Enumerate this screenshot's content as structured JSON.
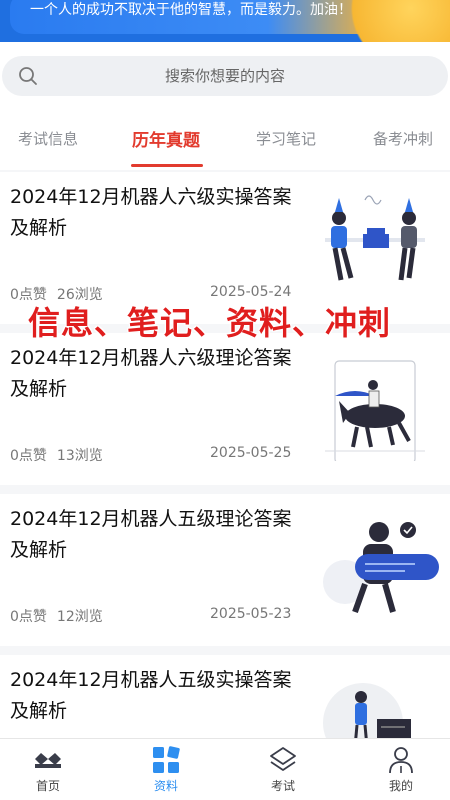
{
  "banner": {
    "quote": "一个人的成功不取决于他的智慧，而是毅力。加油！"
  },
  "search": {
    "placeholder": "搜索你想要的内容"
  },
  "tabs": [
    {
      "label": "考试信息",
      "active": false
    },
    {
      "label": "历年真题",
      "active": true
    },
    {
      "label": "学习笔记",
      "active": false
    },
    {
      "label": "备考冲刺",
      "active": false
    }
  ],
  "articles": [
    {
      "title": "2024年12月机器人六级实操答案及解析",
      "likes": "0点赞",
      "views": "26浏览",
      "date": "2025-05-24",
      "image": "party-illustration"
    },
    {
      "title": "2024年12月机器人六级理论答案及解析",
      "likes": "0点赞",
      "views": "13浏览",
      "date": "2025-05-25",
      "image": "horse-rider-illustration"
    },
    {
      "title": "2024年12月机器人五级理论答案及解析",
      "likes": "0点赞",
      "views": "12浏览",
      "date": "2025-05-23",
      "image": "chat-illustration"
    },
    {
      "title": "2024年12月机器人五级实操答案及解析",
      "likes": "",
      "views": "",
      "date": "",
      "image": "presentation-illustration"
    }
  ],
  "overlay": {
    "text": "信息、笔记、资料、冲刺"
  },
  "bottom_nav": [
    {
      "label": "首页",
      "icon": "home-icon",
      "active": false
    },
    {
      "label": "资料",
      "icon": "grid-icon",
      "active": true
    },
    {
      "label": "考试",
      "icon": "layers-icon",
      "active": false
    },
    {
      "label": "我的",
      "icon": "user-icon",
      "active": false
    }
  ],
  "colors": {
    "accent": "#e23b2e",
    "nav_active": "#2e8ff0",
    "overlay": "#e01e1e"
  }
}
